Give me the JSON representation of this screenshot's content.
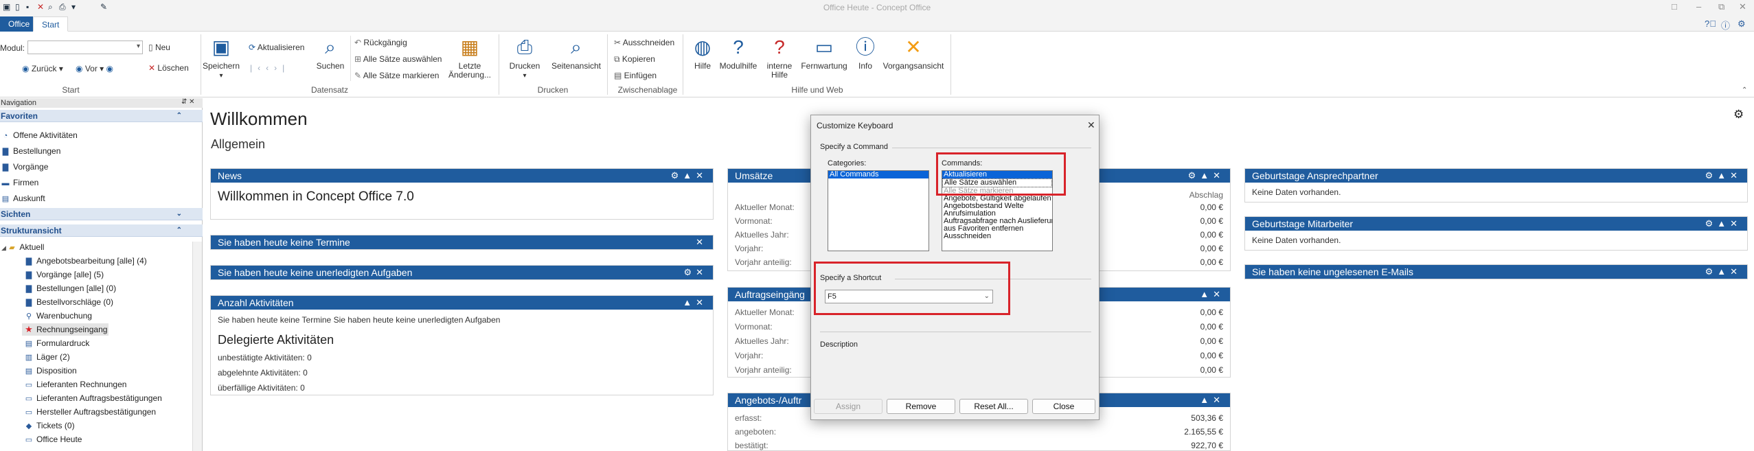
{
  "window": {
    "title": "Office Heute - Concept Office",
    "controls": [
      "□",
      "–",
      "⧉",
      "✕"
    ]
  },
  "tabs": {
    "office": "Office",
    "start": "Start"
  },
  "ribbon": {
    "start": {
      "modul_label": "Modul:",
      "modul_value": "",
      "neu": "Neu",
      "loeschen": "Löschen",
      "zurueck": "Zurück",
      "vor": "Vor",
      "group": "Start"
    },
    "datensatz": {
      "speichern": "Speichern",
      "aktualisieren": "Aktualisieren",
      "suchen": "Suchen",
      "rueckgaengig": "Rückgängig",
      "alle_auswaehlen": "Alle Sätze auswählen",
      "alle_markieren": "Alle Sätze markieren",
      "letzte1": "Letzte",
      "letzte2": "Änderung...",
      "group": "Datensatz"
    },
    "drucken": {
      "drucken": "Drucken",
      "seitenansicht": "Seitenansicht",
      "group": "Drucken"
    },
    "zwischenablage": {
      "ausschneiden": "Ausschneiden",
      "kopieren": "Kopieren",
      "einfuegen": "Einfügen",
      "group": "Zwischenablage"
    },
    "hilfe": {
      "hilfe": "Hilfe",
      "modulhilfe": "Modulhilfe",
      "interne1": "interne",
      "interne2": "Hilfe",
      "fernwartung": "Fernwartung",
      "info": "Info",
      "vorgangsansicht": "Vorgangsansicht",
      "group": "Hilfe und Web"
    }
  },
  "nav": {
    "title": "Navigation",
    "pin": "⇵ ✕",
    "favoriten": "Favoriten",
    "fav_items": [
      "Offene Aktivitäten",
      "Bestellungen",
      "Vorgänge",
      "Firmen",
      "Auskunft"
    ],
    "sichten": "Sichten",
    "strukturansicht": "Strukturansicht",
    "aktuell": "Aktuell",
    "tree_items": [
      "Angebotsbearbeitung [alle] (4)",
      "Vorgänge [alle] (5)",
      "Bestellungen [alle] (0)",
      "Bestellvorschläge (0)",
      "Warenbuchung",
      "Rechnungseingang",
      "Formulardruck",
      "Läger (2)",
      "Disposition",
      "Lieferanten Rechnungen",
      "Lieferanten Auftragsbestätigungen",
      "Hersteller Auftragsbestätigungen",
      "Tickets (0)",
      "Office Heute"
    ]
  },
  "main": {
    "title": "Willkommen",
    "subtitle": "Allgemein",
    "news": {
      "header": "News",
      "text": "Willkommen in Concept Office 7.0"
    },
    "termine": {
      "header": "Sie haben heute keine Termine"
    },
    "aufgaben": {
      "header": "Sie haben heute keine unerledigten Aufgaben"
    },
    "aktivitaeten": {
      "header": "Anzahl Aktivitäten",
      "line": "Sie haben heute keine Termine Sie haben heute keine unerledigten Aufgaben",
      "delegiert": "Delegierte Aktivitäten",
      "rows": [
        "unbestätigte Aktivitäten: 0",
        "abgelehnte Aktivitäten: 0",
        "überfällige Aktivitäten: 0"
      ]
    },
    "umsaetze": {
      "header": "Umsätze",
      "col": "Abschlag",
      "rows": [
        {
          "label": "Aktueller Monat:",
          "value": "0,00 €"
        },
        {
          "label": "Vormonat:",
          "value": "0,00 €"
        },
        {
          "label": "Aktuelles Jahr:",
          "value": "0,00 €"
        },
        {
          "label": "Vorjahr:",
          "value": "0,00 €"
        },
        {
          "label": "Vorjahr anteilig:",
          "value": "0,00 €"
        }
      ]
    },
    "auftragseingang": {
      "header": "Auftragseingäng",
      "rows": [
        {
          "label": "Aktueller Monat:",
          "value": "0,00 €"
        },
        {
          "label": "Vormonat:",
          "value": "0,00 €"
        },
        {
          "label": "Aktuelles Jahr:",
          "value": "0,00 €"
        },
        {
          "label": "Vorjahr:",
          "value": "0,00 €"
        },
        {
          "label": "Vorjahr anteilig:",
          "value": "0,00 €"
        }
      ]
    },
    "angebote": {
      "header": "Angebots-/Auftr",
      "rows": [
        {
          "label": "erfasst:",
          "value": "503,36 €"
        },
        {
          "label": "angeboten:",
          "value": "2.165,55 €"
        },
        {
          "label": "bestätigt:",
          "value": "922,70 €"
        }
      ]
    },
    "geburtstage_ap": {
      "header": "Geburtstage Ansprechpartner",
      "text": "Keine Daten vorhanden."
    },
    "geburtstage_ma": {
      "header": "Geburtstage Mitarbeiter",
      "text": "Keine Daten vorhanden."
    },
    "emails": {
      "header": "Sie haben keine ungelesenen E-Mails"
    }
  },
  "dialog": {
    "title": "Customize Keyboard",
    "specify_command": "Specify a Command",
    "categories_label": "Categories:",
    "categories": [
      "All Commands"
    ],
    "commands_label": "Commands:",
    "commands": [
      "Aktualisieren",
      "Alle Sätze auswählen",
      "Alle Sätze markieren",
      "Angebote, Gültigkeit abgelaufen",
      "Angebotsbestand Welte",
      "Anrufsimulation",
      "Auftragsabfrage nach Auslieferung",
      "aus Favoriten entfernen",
      "Ausschneiden"
    ],
    "specify_shortcut": "Specify a Shortcut",
    "shortcut_value": "F5",
    "description_label": "Description",
    "assign": "Assign",
    "remove": "Remove",
    "reset_all": "Reset All...",
    "close": "Close"
  },
  "colors": {
    "accent": "#1f5c9e",
    "highlight": "#d8232a"
  }
}
